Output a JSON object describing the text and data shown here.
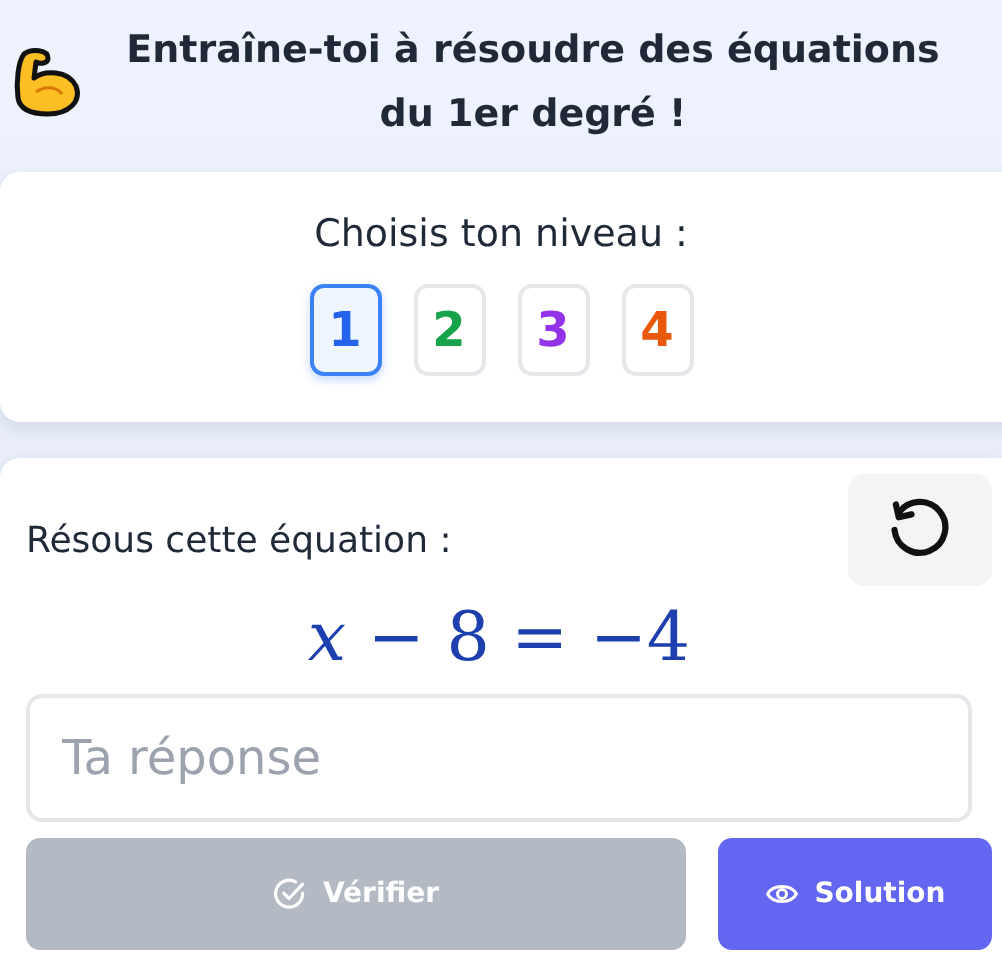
{
  "header": {
    "title": "Entraîne-toi à résoudre des équations du 1er degré !"
  },
  "level_picker": {
    "label": "Choisis ton niveau :",
    "levels": [
      {
        "label": "1",
        "selected": true,
        "color": "#2563eb"
      },
      {
        "label": "2",
        "selected": false,
        "color": "#16a34a"
      },
      {
        "label": "3",
        "selected": false,
        "color": "#9333ea"
      },
      {
        "label": "4",
        "selected": false,
        "color": "#ea580c"
      }
    ]
  },
  "exercise": {
    "prompt": "Résous cette équation :",
    "equation": "*x* − 8 = −4",
    "answer": {
      "placeholder": "Ta réponse"
    },
    "buttons": [
      {
        "kind": "check",
        "label": "Vérifier",
        "disabled": true
      },
      {
        "kind": "solution",
        "label": "Solution",
        "disabled": false
      }
    ]
  }
}
